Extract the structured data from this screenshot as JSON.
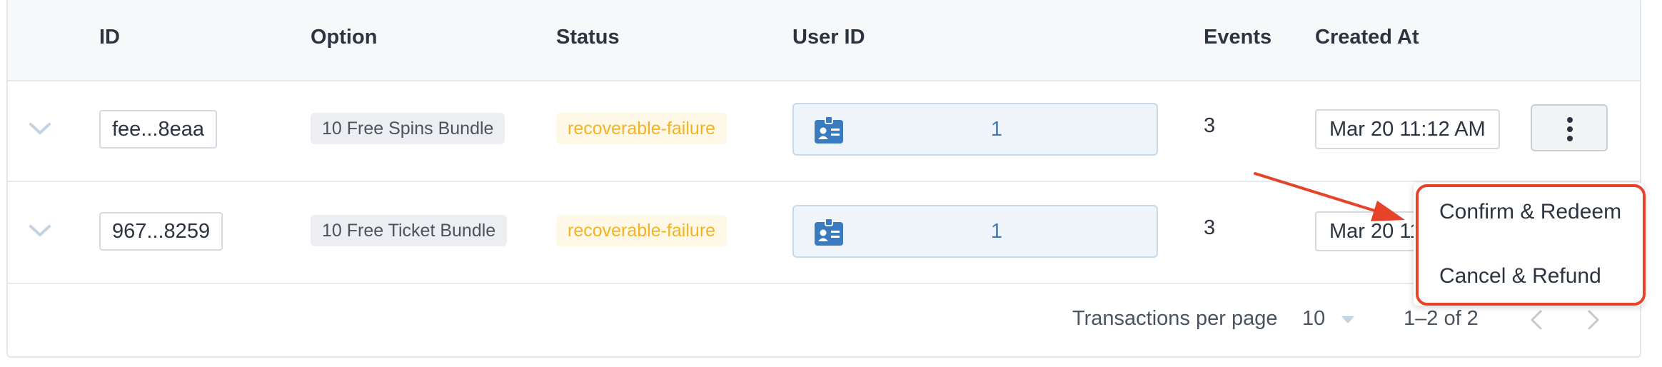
{
  "table": {
    "headers": {
      "id": "ID",
      "option": "Option",
      "status": "Status",
      "user_id": "User ID",
      "events": "Events",
      "created_at": "Created At"
    },
    "rows": [
      {
        "id": "fee...8eaa",
        "option": "10 Free Spins Bundle",
        "status": "recoverable-failure",
        "user_id": "1",
        "events": "3",
        "created_at": "Mar 20 11:12 AM"
      },
      {
        "id": "967...8259",
        "option": "10 Free Ticket Bundle",
        "status": "recoverable-failure",
        "user_id": "1",
        "events": "3",
        "created_at": "Mar 20 11:12 AM"
      }
    ]
  },
  "pagination": {
    "rows_per_page_label": "Transactions per page",
    "rows_per_page_value": "10",
    "range": "1–2 of 2"
  },
  "context_menu": {
    "items": [
      "Confirm & Redeem",
      "Cancel & Refund"
    ]
  },
  "icons": {
    "expand": "chevron-down-icon",
    "user_badge": "id-badge-icon",
    "more": "more-vertical-icon",
    "select_caret": "caret-down-icon",
    "prev": "chevron-left-icon",
    "next": "chevron-right-icon"
  },
  "colors": {
    "status_warning": "#f2b425",
    "user_link": "#3a7bc0",
    "annotation": "#e5442b"
  }
}
